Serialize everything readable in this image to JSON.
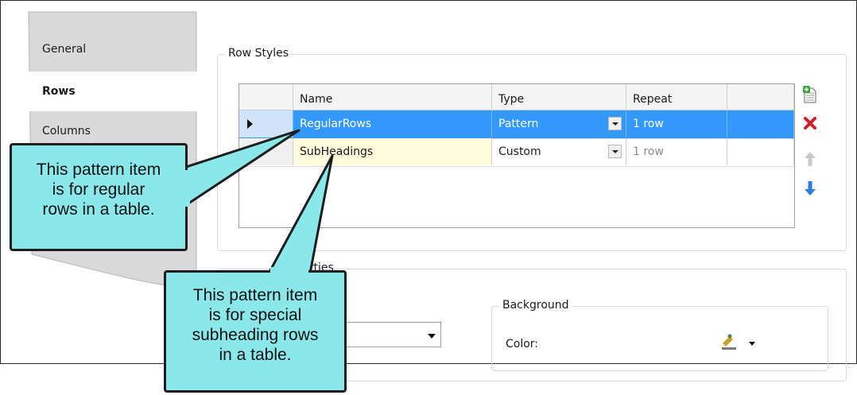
{
  "tabs": [
    {
      "label": "General",
      "active": false
    },
    {
      "label": "Rows",
      "active": true
    },
    {
      "label": "Columns",
      "active": false
    }
  ],
  "row_styles": {
    "title": "Row Styles",
    "columns": [
      "Name",
      "Type",
      "Repeat"
    ],
    "rows": [
      {
        "name": "RegularRows",
        "type": "Pattern",
        "repeat": "1 row",
        "selected": true
      },
      {
        "name": "SubHeadings",
        "type": "Custom",
        "repeat": "1 row",
        "selected": false
      }
    ]
  },
  "toolbar_icons": [
    "add-row-icon",
    "delete-icon",
    "move-up-icon",
    "move-down-icon"
  ],
  "properties": {
    "title_fragment": "Properties",
    "background_title": "Background",
    "color_label": "Color:"
  },
  "callouts": [
    {
      "lines": [
        "This pattern item",
        "is for regular",
        "rows in a table."
      ]
    },
    {
      "lines": [
        "This pattern item",
        "is for special",
        "subheading rows",
        "in a table."
      ]
    }
  ],
  "colors": {
    "selection": "#3399ff",
    "callout_fill": "#8ae8ea",
    "tab_strip": "#d9d9d9",
    "delete": "#d0202a",
    "arrow_down": "#2f7fd8"
  }
}
